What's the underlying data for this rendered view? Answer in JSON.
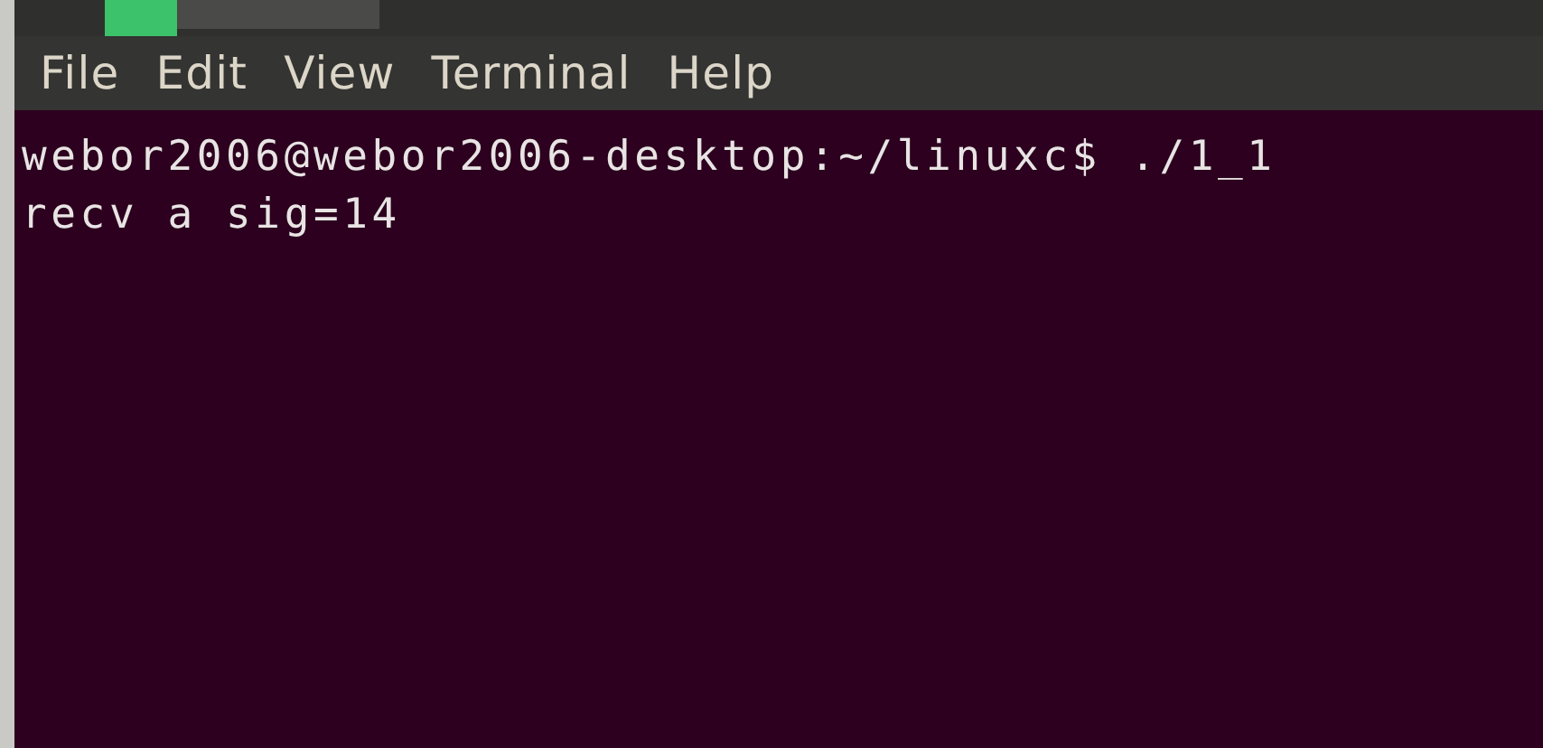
{
  "menu": [
    "File",
    "Edit",
    "View",
    "Terminal",
    "Help"
  ],
  "terminal": {
    "lines": [
      "webor2006@webor2006-desktop:~/linuxc$ ./1_1",
      "recv a sig=14"
    ]
  }
}
